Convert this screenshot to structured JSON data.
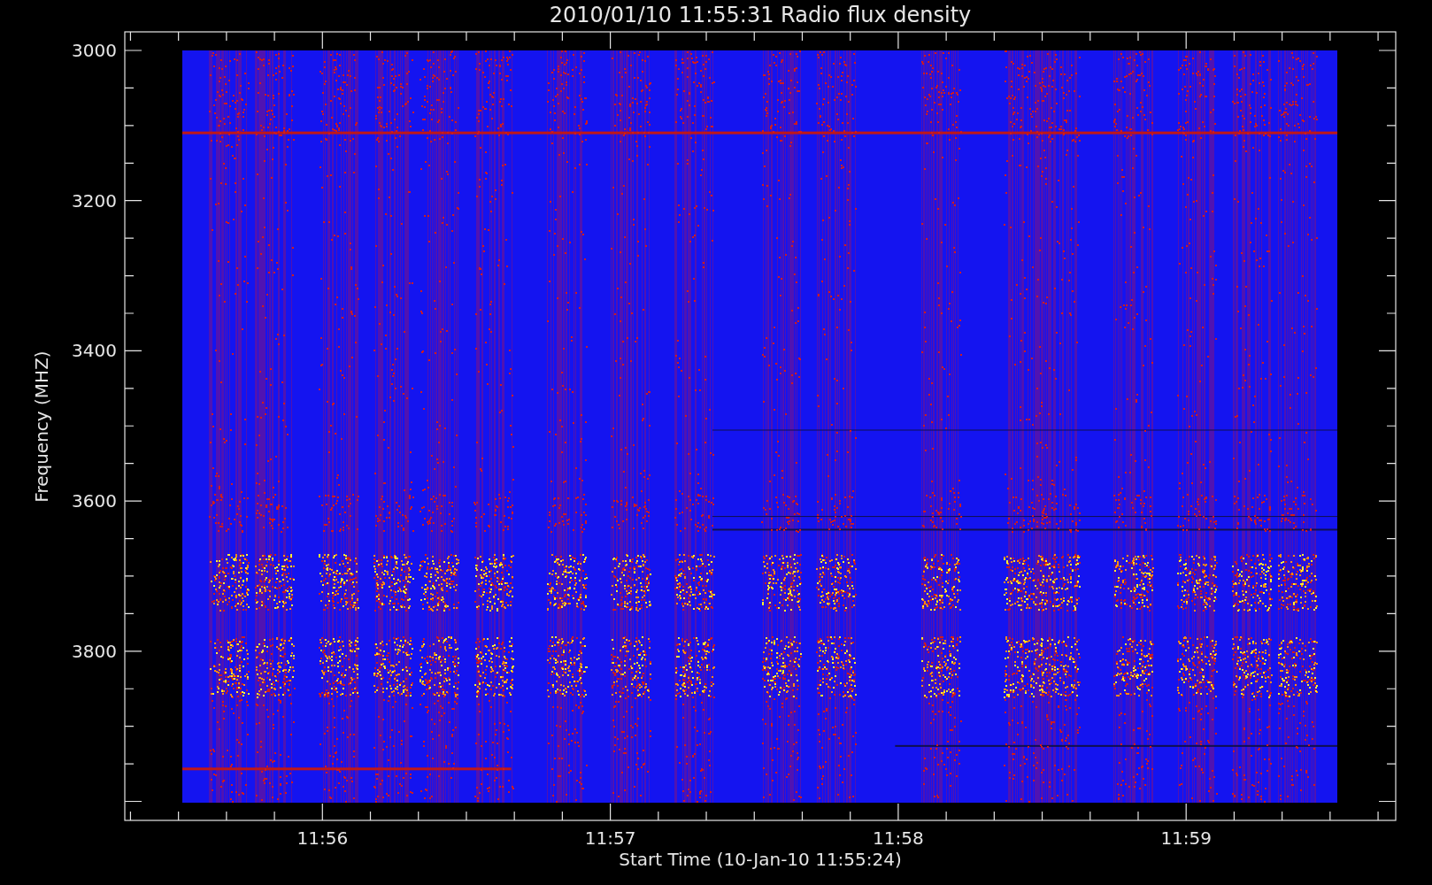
{
  "title": "2010/01/10 11:55:31 Radio flux density",
  "y_axis": {
    "label": "Frequency (MHZ)",
    "ticks": [
      "3000",
      "3200",
      "3400",
      "3600",
      "3800"
    ]
  },
  "x_axis": {
    "label": "Start Time (10-Jan-10 11:55:24)",
    "ticks": [
      "11:56",
      "11:57",
      "11:58",
      "11:59"
    ]
  }
}
